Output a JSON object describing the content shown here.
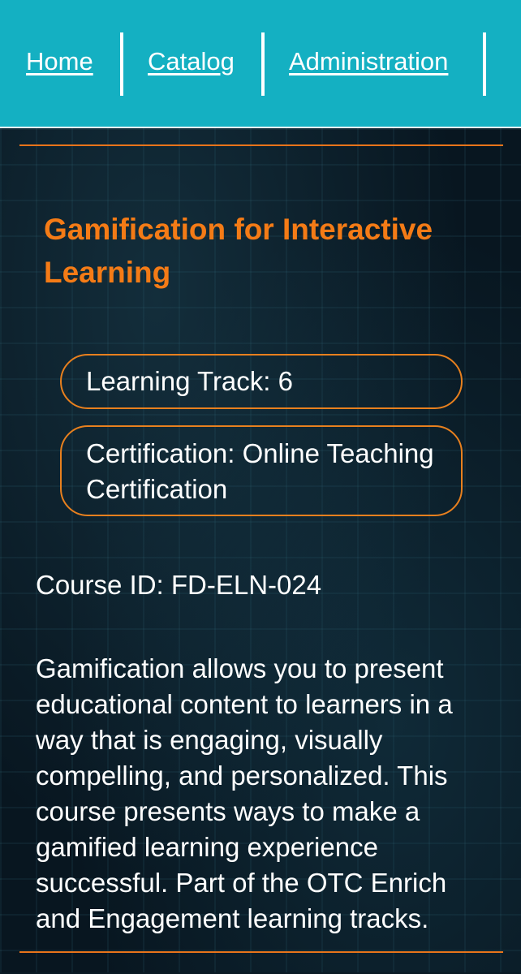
{
  "nav": {
    "items": [
      {
        "label": "Home"
      },
      {
        "label": "Catalog"
      },
      {
        "label": "Administration"
      }
    ]
  },
  "course": {
    "title": "Gamification for Interactive Learning",
    "learning_track": "Learning Track: 6",
    "certification": "Certification: Online Teaching Certification",
    "course_id": "Course ID: FD-ELN-024",
    "description": "Gamification allows you to present educational content to learners in a way that is engaging, visually compelling, and personalized. This course presents ways to make a gamified learning experience successful. Part of the OTC Enrich and Engagement learning tracks."
  },
  "colors": {
    "nav_background": "#14b0c2",
    "accent_orange": "#f47b16",
    "page_background": "#081620"
  }
}
